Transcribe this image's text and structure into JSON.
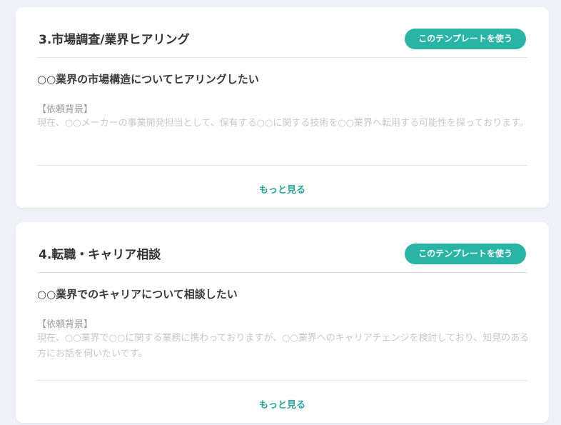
{
  "templates": [
    {
      "title": "3.市場調査/業界ヒアリング",
      "use_button": "このテンプレートを使う",
      "subject": "○○業界の市場構造についてヒアリングしたい",
      "background_label": "【依頼背景】",
      "background_text": "現在、○○メーカーの事業開発担当として、保有する○○に関する技術を○○業界へ転用する可能性を探っております。",
      "more_link": "もっと見る"
    },
    {
      "title": "4.転職・キャリア相談",
      "use_button": "このテンプレートを使う",
      "subject": "○○業界でのキャリアについて相談したい",
      "background_label": "【依頼背景】",
      "background_text": "現在、○○業界で○○に関する業務に携わっておりますが、○○業界へのキャリアチェンジを検討しており、知見のある方にお話を伺いたいです。",
      "more_link": "もっと見る"
    }
  ],
  "colors": {
    "accent": "#28b5a5",
    "page_background": "#eef2f8",
    "card_background": "#ffffff"
  }
}
